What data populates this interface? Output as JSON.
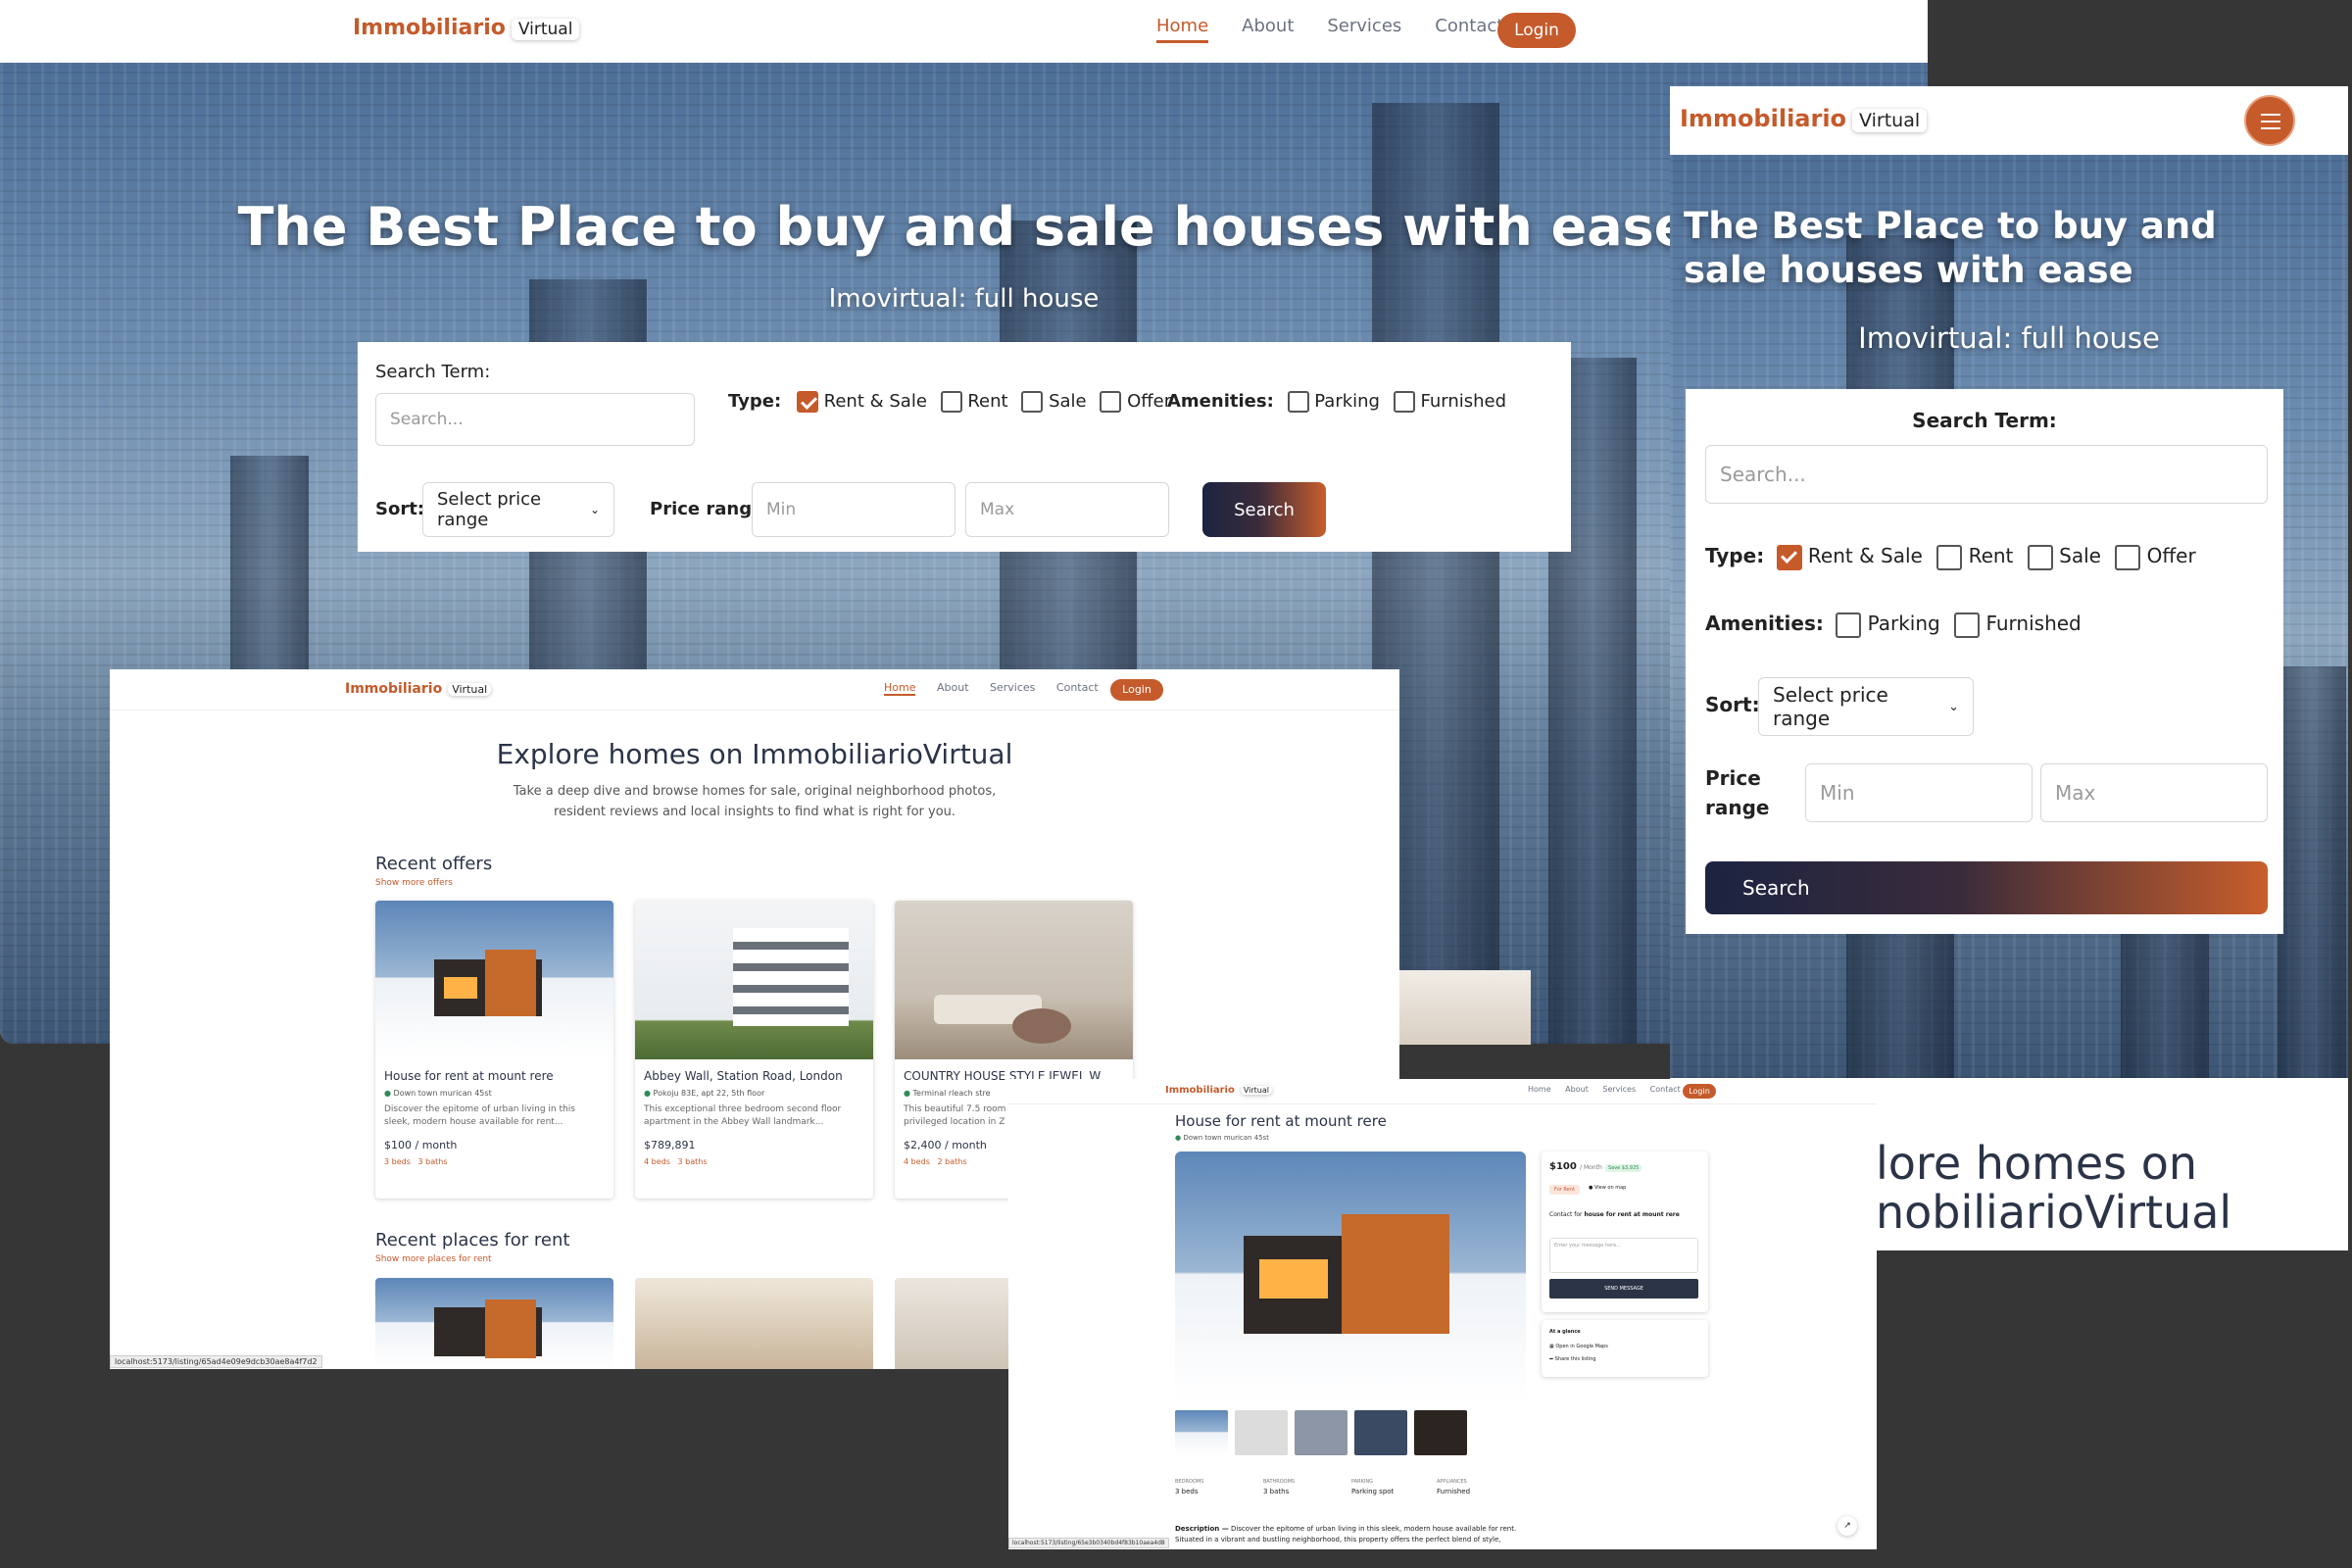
{
  "brand": {
    "name": "Immobiliario",
    "suffix": "Virtual"
  },
  "nav": {
    "home": "Home",
    "about": "About",
    "services": "Services",
    "contact": "Contact",
    "login": "Login"
  },
  "hero": {
    "title": "The Best Place to buy and sale houses with ease",
    "subtitle": "Imovirtual: full house"
  },
  "search": {
    "term_label": "Search Term:",
    "placeholder": "Search...",
    "type_label": "Type:",
    "types": [
      "Rent & Sale",
      "Rent",
      "Sale",
      "Offer"
    ],
    "amenities_label": "Amenities:",
    "amenities": [
      "Parking",
      "Furnished"
    ],
    "sort_label": "Sort:",
    "sort_value": "Select price range",
    "price_label": "Price range",
    "price_label_line1": "Price",
    "price_label_line2": "range",
    "min_placeholder": "Min",
    "max_placeholder": "Max",
    "button": "Search"
  },
  "explore": {
    "title": "Explore homes on ImmobiliarioVirtual",
    "description_line1": "Take a deep dive and browse homes for sale, original neighborhood photos,",
    "description_line2": "resident reviews and local insights to find what is right for you.",
    "mobile_title_line1": "lore homes on",
    "mobile_title_line2": "nobiliarioVirtual"
  },
  "recent_offers": {
    "title": "Recent offers",
    "link": "Show more offers",
    "cards": [
      {
        "title": "House for rent at mount rere",
        "location": "Down town murican 45st",
        "desc1": "Discover the epitome of urban living in this",
        "desc2": "sleek, modern house available for rent...",
        "price": "$100 / month",
        "beds": "3 beds",
        "baths": "3 baths"
      },
      {
        "title": "Abbey Wall, Station Road, London",
        "location": "Pokoju 83E, apt 22, 5th floor",
        "desc1": "This exceptional three bedroom second floor",
        "desc2": "apartment in the Abbey Wall landmark...",
        "price": "$789,891",
        "beds": "4 beds",
        "baths": "3 baths"
      },
      {
        "title": "COUNTRY HOUSE STYLE JEWEL W",
        "location": "Terminal rleach stre",
        "desc1": "This beautiful 7.5 room",
        "desc2": "privileged location in Z",
        "price": "$2,400 / month",
        "beds": "4 beds",
        "baths": "2 baths"
      }
    ]
  },
  "recent_rent": {
    "title": "Recent places for rent",
    "link": "Show more places for rent"
  },
  "status_bar_1": "localhost:5173/listing/65ad4e09e9dcb30ae8a4f7d2",
  "status_bar_2": "localhost:5173/listing/65e3b0340bd4f83b10aea4d8",
  "detail": {
    "title": "House for rent at mount rere",
    "location": "Down town murican 45st",
    "price": "$100",
    "per": "/ Month",
    "save": "Save $3,925",
    "badge": "For Rent",
    "map_link": "View on map",
    "contact_prefix": "Contact for",
    "contact_name": "house for rent at mount rere",
    "message_placeholder": "Enter your message here...",
    "send": "SEND MESSAGE",
    "glance_title": "At a glance",
    "glance_1": "Open in Google Maps",
    "glance_2": "Share this listing",
    "facts": [
      {
        "label": "BEDROOMS",
        "value": "3 beds"
      },
      {
        "label": "BATHROOMS",
        "value": "3 baths"
      },
      {
        "label": "PARKING",
        "value": "Parking spot"
      },
      {
        "label": "APPLIANCES",
        "value": "Furnished"
      }
    ],
    "description_label": "Description —",
    "description_line1": "Discover the epitome of urban living in this sleek, modern house available for rent.",
    "description_line2": "Situated in a vibrant and bustling neighborhood, this property offers the perfect blend of style,"
  },
  "colors": {
    "accent": "#c55a2b",
    "dark": "#1c2441",
    "backdrop": "#363636"
  }
}
